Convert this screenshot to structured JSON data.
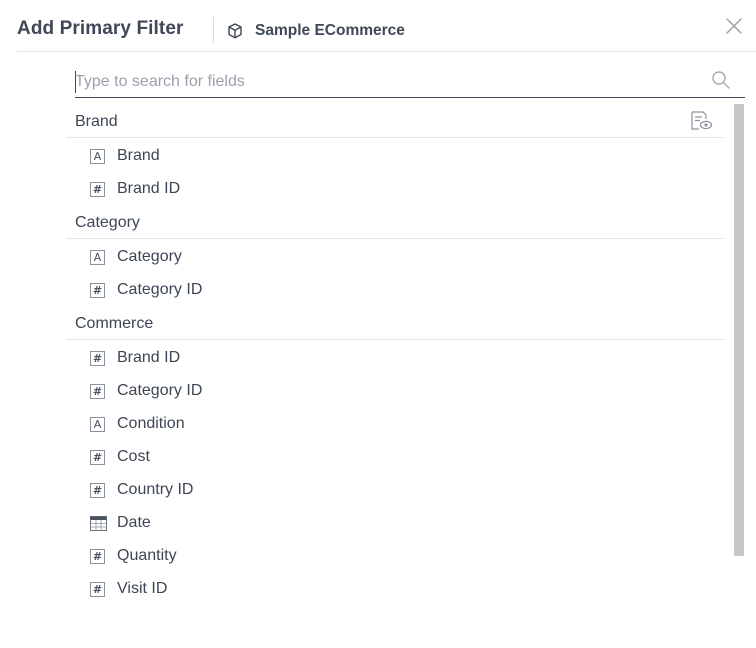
{
  "header": {
    "title": "Add Primary Filter",
    "datasource": "Sample ECommerce"
  },
  "search": {
    "placeholder": "Type to search for fields",
    "value": ""
  },
  "groups": [
    {
      "label": "Brand",
      "fields": [
        {
          "label": "Brand",
          "type": "text"
        },
        {
          "label": "Brand ID",
          "type": "number"
        }
      ]
    },
    {
      "label": "Category",
      "fields": [
        {
          "label": "Category",
          "type": "text"
        },
        {
          "label": "Category ID",
          "type": "number"
        }
      ]
    },
    {
      "label": "Commerce",
      "fields": [
        {
          "label": "Brand ID",
          "type": "number"
        },
        {
          "label": "Category ID",
          "type": "number"
        },
        {
          "label": "Condition",
          "type": "text"
        },
        {
          "label": "Cost",
          "type": "number"
        },
        {
          "label": "Country ID",
          "type": "number"
        },
        {
          "label": "Date",
          "type": "date"
        },
        {
          "label": "Quantity",
          "type": "number"
        },
        {
          "label": "Visit ID",
          "type": "number"
        }
      ]
    }
  ],
  "icons": {
    "text": "A",
    "number": "#",
    "datasource": "cube-icon",
    "close": "close-icon",
    "search": "search-icon",
    "preview": "preview-eye-icon"
  },
  "colors": {
    "text": "#3d4654",
    "border": "#e2e4e8",
    "scrollbar": "#c4c6c9"
  }
}
